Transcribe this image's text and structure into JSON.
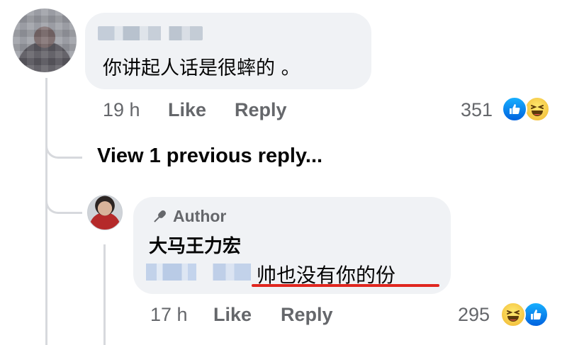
{
  "comment1": {
    "text": "你讲起人话是很蟀的 。",
    "time": "19 h",
    "like_label": "Like",
    "reply_label": "Reply",
    "reaction_count": "351",
    "reactions": [
      "like-icon",
      "haha-icon"
    ]
  },
  "view_previous": "View 1 previous reply...",
  "reply": {
    "author_badge": "Author",
    "author_name": "大马王力宏",
    "text": "帅也没有你的份",
    "time": "17 h",
    "like_label": "Like",
    "reply_label": "Reply",
    "reaction_count": "295",
    "reactions": [
      "haha-icon",
      "like-icon"
    ]
  },
  "colors": {
    "bubble": "#f0f2f5",
    "meta": "#65676b",
    "underline": "#e0261f",
    "like_blue": "#0866ff"
  }
}
